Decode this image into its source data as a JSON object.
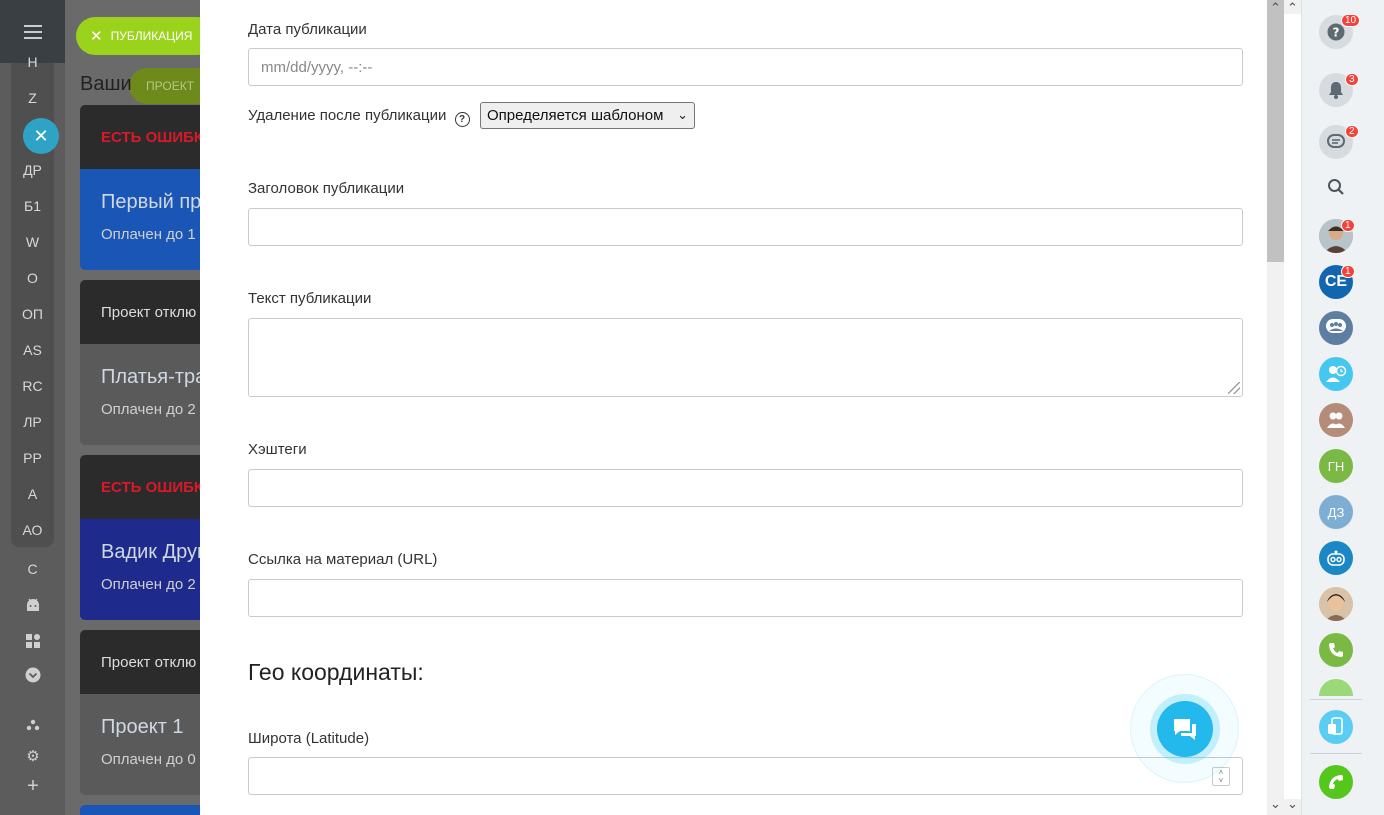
{
  "left_nav": {
    "items": [
      "Н",
      "Z",
      "ДР",
      "Б1",
      "W",
      "О",
      "ОП",
      "AS",
      "RC",
      "ЛР",
      "PP",
      "А",
      "АО",
      "С"
    ]
  },
  "background": {
    "pill_green": "ПУБЛИКАЦИЯ",
    "pill_olive": "ПРОЕКТ",
    "section_title": "Ваши",
    "cards": [
      {
        "status": "ЕСТЬ ОШИБКИ",
        "name": "Первый пр",
        "paid": "Оплачен до 1",
        "color": "#1a56b5"
      },
      {
        "status": "Проект отклю",
        "name": "Платья-тра",
        "paid": "Оплачен до 2",
        "color": "#5a5a5a"
      },
      {
        "status": "ЕСТЬ ОШИБКИ",
        "name": "Вадик Друг",
        "paid": "Оплачен до 2",
        "color": "#1e2a8c"
      },
      {
        "status": "Проект отклю",
        "name": "Проект 1",
        "paid": "Оплачен до 0",
        "color": "#5a5a5a"
      }
    ]
  },
  "form": {
    "date_label": "Дата публикации",
    "date_placeholder": "mm/dd/yyyy, --:--",
    "delete_label": "Удаление после публикации",
    "delete_value": "Определяется шаблоном",
    "title_label": "Заголовок публикации",
    "text_label": "Текст публикации",
    "hashtags_label": "Хэштеги",
    "url_label": "Ссылка на материал (URL)",
    "geo_title": "Гео координаты:",
    "lat_label": "Широта (Latitude)"
  },
  "right_bar": {
    "badges": {
      "help": "10",
      "notifications": "3",
      "chats": "2",
      "user1": "1",
      "ce": "1"
    },
    "avatars": {
      "ce": "CE",
      "gn": "ГН",
      "dz": "ДЗ"
    }
  },
  "colors": {
    "accent": "#23b9ec",
    "badge": "#f4433b",
    "error_text": "#d7192a",
    "call": "#9bd21b"
  }
}
